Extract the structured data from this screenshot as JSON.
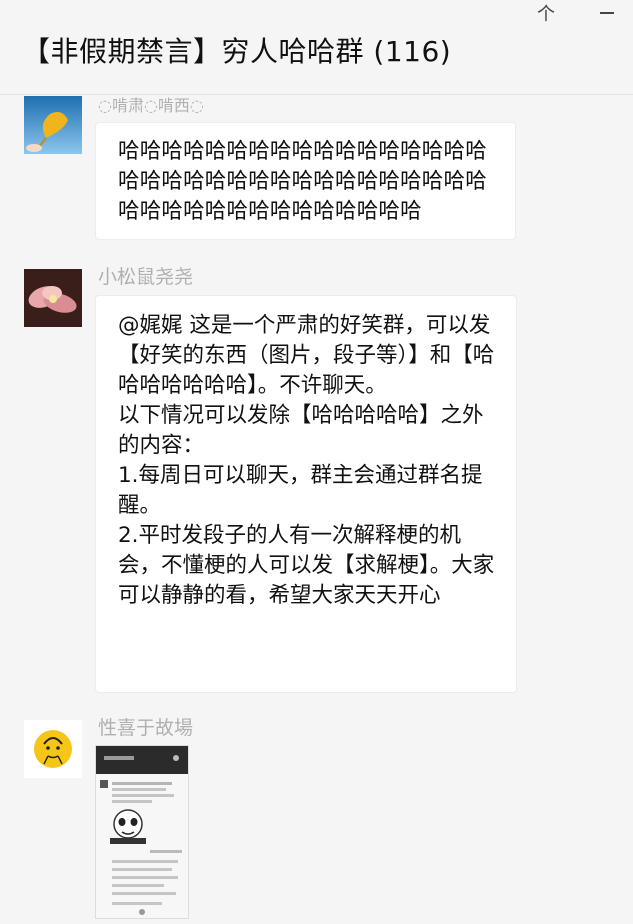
{
  "window": {
    "title": "【非假期禁言】穷人哈哈群 (116)",
    "pin_glyph": "个",
    "colors": {
      "background": "#f5f5f5",
      "bubble": "#ffffff",
      "sender_name": "#b0b0b0"
    }
  },
  "messages": [
    {
      "sender": "◌啃肃◌啃西◌",
      "text": "哈哈哈哈哈哈哈哈哈哈哈哈哈哈哈哈哈哈哈哈哈哈哈哈哈哈哈哈哈哈哈哈哈哈哈哈哈哈哈哈哈哈哈哈哈哈哈哈",
      "avatar_icon": "ginkgo-leaf-sky-photo"
    },
    {
      "sender": "小松鼠尧尧",
      "mention": "@娓娓",
      "lines": [
        " 这是一个严肃的好笑群，可以发【好笑的东西（图片，段子等）】和【哈哈哈哈哈哈哈】。不许聊天。",
        "以下情况可以发除【哈哈哈哈哈】之外的内容：",
        "1.每周日可以聊天，群主会通过群名提醒。",
        "2.平时发段子的人有一次解释梗的机会，不懂梗的人可以发【求解梗】。大家可以静静的看，希望大家天天开心"
      ],
      "avatar_icon": "pink-flower-photo"
    },
    {
      "sender": "性喜于故場",
      "avatar_icon": "cartoon-face-yellow",
      "attachment_icon": "chat-screenshot-image"
    }
  ]
}
